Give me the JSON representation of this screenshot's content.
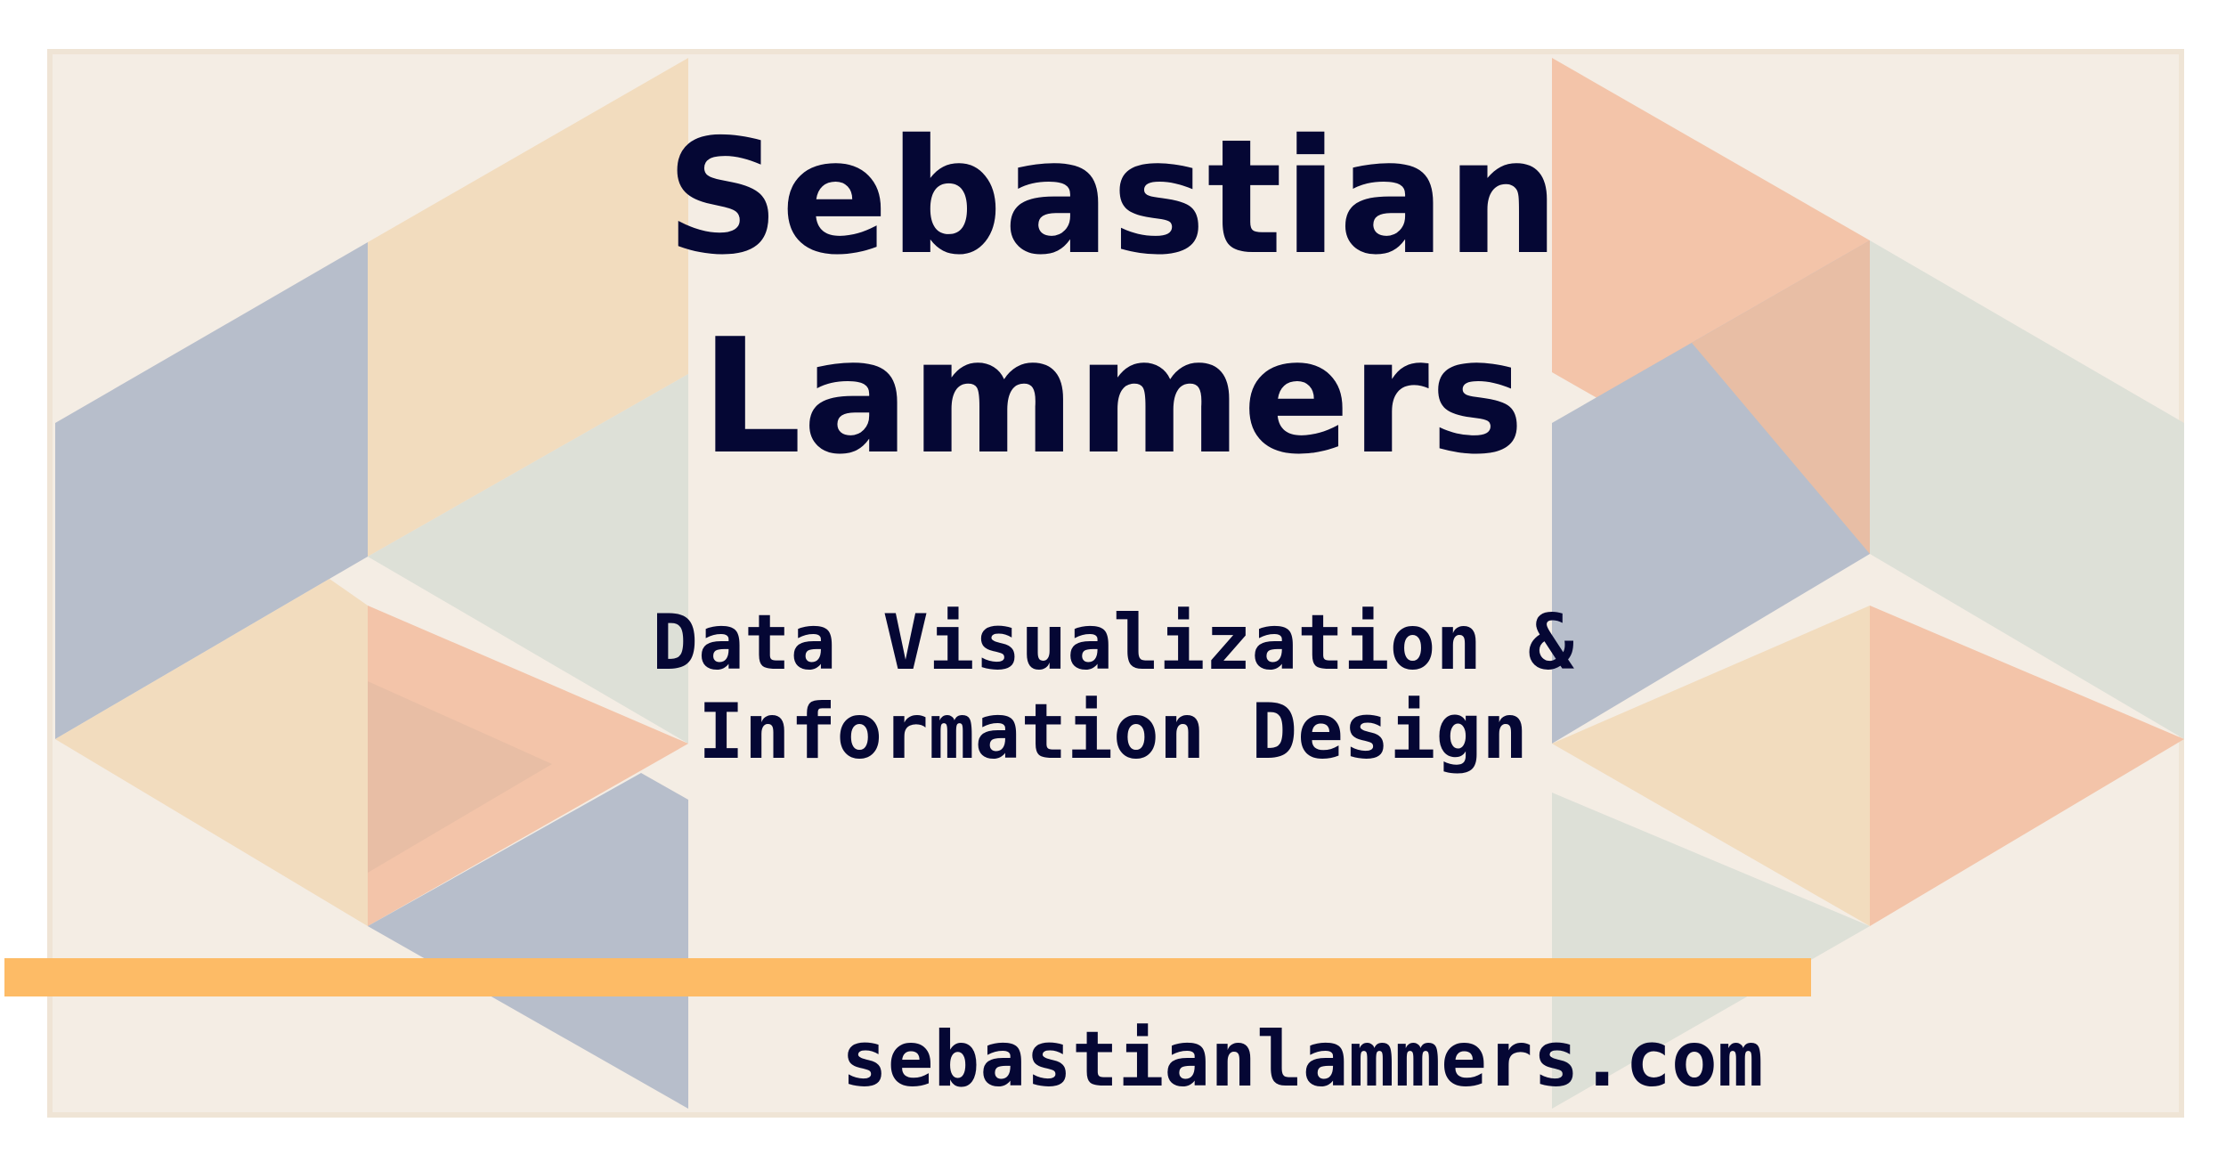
{
  "card": {
    "name_first": "Sebastian",
    "name_last": "Lammers",
    "subtitle_line1": "Data Visualization &",
    "subtitle_line2": "Information Design",
    "website": "sebastianlammers.com"
  },
  "colors": {
    "background": "#f4ede4",
    "border": "#efe4d5",
    "text": "#050734",
    "accent_bar": "#fdbb66",
    "pattern_blue": "#b7becb",
    "pattern_peach": "#f2dcbe",
    "pattern_sage": "#dde0d7",
    "pattern_salmon": "#f3c4a9",
    "pattern_blend": "#e8bea5"
  }
}
